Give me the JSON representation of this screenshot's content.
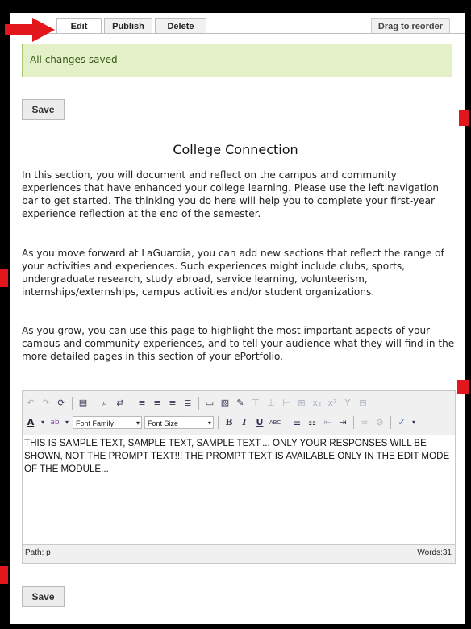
{
  "tabs": {
    "edit": "Edit",
    "publish": "Publish",
    "delete": "Delete",
    "drag": "Drag to reorder"
  },
  "status_message": "All changes saved",
  "buttons": {
    "save_top": "Save",
    "save_bottom": "Save"
  },
  "section": {
    "title": "College Connection",
    "paragraphs": [
      "In this section, you will document and reflect on the campus and community experiences that have enhanced your college learning. Please use the left navigation bar to get started. The thinking you do here will help you to complete your first-year experience reflection at the end of the semester.",
      "As you move forward at LaGuardia, you can add new sections that reflect the range of your activities and experiences. Such experiences might include clubs, sports, undergraduate research, study abroad, service learning, volunteerism, internships/externships, campus activities and/or student organizations.",
      "As you grow, you can use this page to highlight the most important aspects of your campus and community experiences, and to tell your audience what they will find in the more detailed pages in this section of your ePortfolio."
    ]
  },
  "editor": {
    "font_family": "Font Family",
    "font_size": "Font Size",
    "content": "THIS IS SAMPLE TEXT, SAMPLE TEXT, SAMPLE TEXT.... ONLY YOUR RESPONSES WILL BE SHOWN, NOT THE PROMPT TEXT!!! THE PROMPT TEXT IS AVAILABLE ONLY IN THE EDIT MODE OF THE MODULE...",
    "path": "Path: p",
    "words": "Words:31"
  },
  "colors": {
    "marker": "#e2161b",
    "success_bg": "#e4f1c8",
    "success_border": "#a9c46d"
  }
}
